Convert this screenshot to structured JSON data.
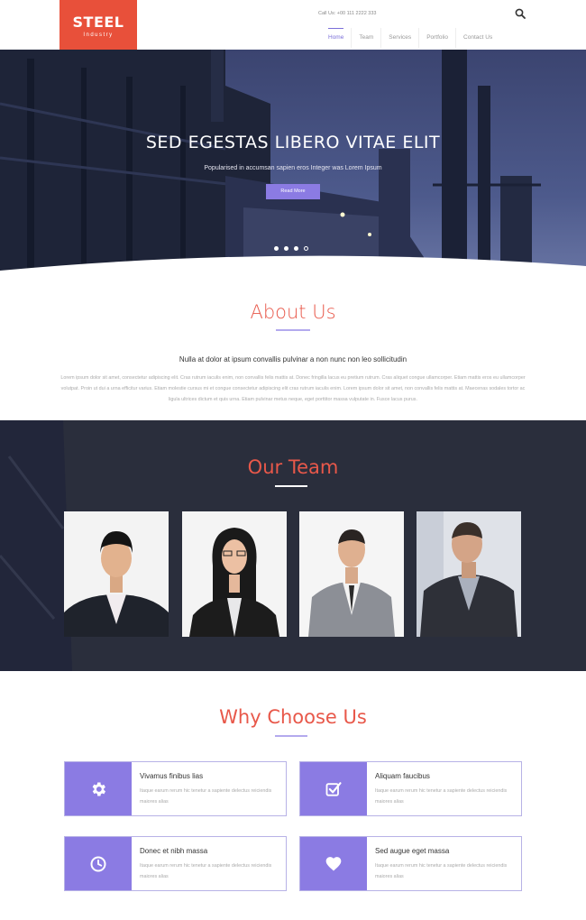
{
  "header": {
    "logo_name": "STEEL",
    "logo_sub": "Industry",
    "phone": "Call Us: +00 111 2222 333",
    "nav": [
      {
        "label": "Home",
        "active": true
      },
      {
        "label": "Team",
        "active": false
      },
      {
        "label": "Services",
        "active": false
      },
      {
        "label": "Portfolio",
        "active": false
      },
      {
        "label": "Contact Us",
        "active": false
      }
    ]
  },
  "hero": {
    "title": "SED EGESTAS LIBERO VITAE ELIT",
    "subtitle": "Popularised in accumsan sapien eros Integer was Lorem Ipsum",
    "button_label": "Read More",
    "slides": 4
  },
  "about": {
    "title": "About Us",
    "lead": "Nulla at dolor at ipsum convallis pulvinar a non nunc non leo sollicitudin",
    "text": "Lorem ipsum dolor sit amet, consectetur adipiscing elit. Cras rutrum iaculis enim, non convallis felis mattis at. Donec fringilla lacus eu pretium rutrum. Cras aliquet congue ullamcorper. Etiam mattis eros eu ullamcorper volutpat. Proin ut dui a urna efficitur varius. Etiam molestie cursus mi et congue consectetur adipiscing elit cras rutrum iaculis enim. Lorem ipsum dolor sit amet, non convallis felis mattis at. Maecenas sodales tortor ac ligula ultrices dictum et quis urna. Etiam pulvinar metus neque, eget porttitor massa vulputate in. Fusce lacus purus."
  },
  "team": {
    "title": "Our Team",
    "members": [
      {
        "name": "team-member-1"
      },
      {
        "name": "team-member-2"
      },
      {
        "name": "team-member-3"
      },
      {
        "name": "team-member-4"
      }
    ]
  },
  "why": {
    "title": "Why Choose Us",
    "features": [
      {
        "title": "Vivamus finibus lias",
        "text": "Itaque earum rerum hic tenetur a sapiente delectus reiciendis maiores alias",
        "icon": "gear-icon"
      },
      {
        "title": "Aliquam faucibus",
        "text": "Itaque earum rerum hic tenetur a sapiente delectus reiciendis maiores alias",
        "icon": "check-square-icon"
      },
      {
        "title": "Donec et nibh massa",
        "text": "Itaque earum rerum hic tenetur a sapiente delectus reiciendis maiores alias",
        "icon": "clock-icon"
      },
      {
        "title": "Sed augue eget massa",
        "text": "Itaque earum rerum hic tenetur a sapiente delectus reiciendis maiores alias",
        "icon": "heart-icon"
      }
    ]
  },
  "colors": {
    "accent": "#8b7be3",
    "brand": "#e8503a",
    "heading": "#e8584a",
    "team_bg": "#2a2e3c"
  }
}
